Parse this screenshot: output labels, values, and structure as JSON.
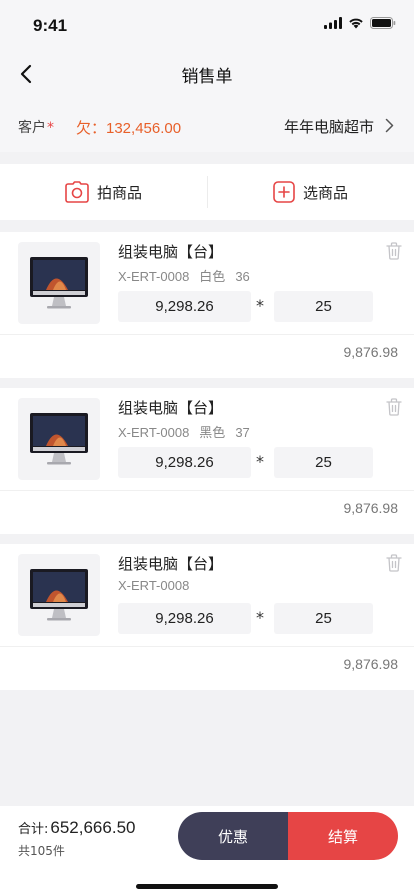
{
  "status": {
    "time": "9:41"
  },
  "nav": {
    "title": "销售单"
  },
  "customer": {
    "label": "客户",
    "required_mark": "*",
    "debt": "欠：132,456.00",
    "name": "年年电脑超市"
  },
  "actions": {
    "photo_label": "拍商品",
    "select_label": "选商品"
  },
  "items": [
    {
      "name": "组装电脑【台】",
      "sku": "X-ERT-0008",
      "color": "白色",
      "stock": "36",
      "price": "9,298.26",
      "qty": "25",
      "subtotal": "9,876.98"
    },
    {
      "name": "组装电脑【台】",
      "sku": "X-ERT-0008",
      "color": "黑色",
      "stock": "37",
      "price": "9,298.26",
      "qty": "25",
      "subtotal": "9,876.98"
    },
    {
      "name": "组装电脑【台】",
      "sku": "X-ERT-0008",
      "color": "",
      "stock": "",
      "price": "9,298.26",
      "qty": "25",
      "subtotal": "9,876.98"
    }
  ],
  "multiply_symbol": "*",
  "footer": {
    "total_label": "合计:",
    "total_amount": "652,666.50",
    "count": "共105件",
    "discount_label": "优惠",
    "checkout_label": "结算"
  },
  "colors": {
    "accent_red": "#e64545",
    "dark_button": "#3f3f58",
    "debt_orange": "#e8602a"
  },
  "icons": [
    "signal-icon",
    "wifi-icon",
    "battery-icon",
    "back-icon",
    "chevron-right-icon",
    "camera-icon",
    "add-square-icon",
    "trash-icon",
    "computer-thumbnail"
  ]
}
